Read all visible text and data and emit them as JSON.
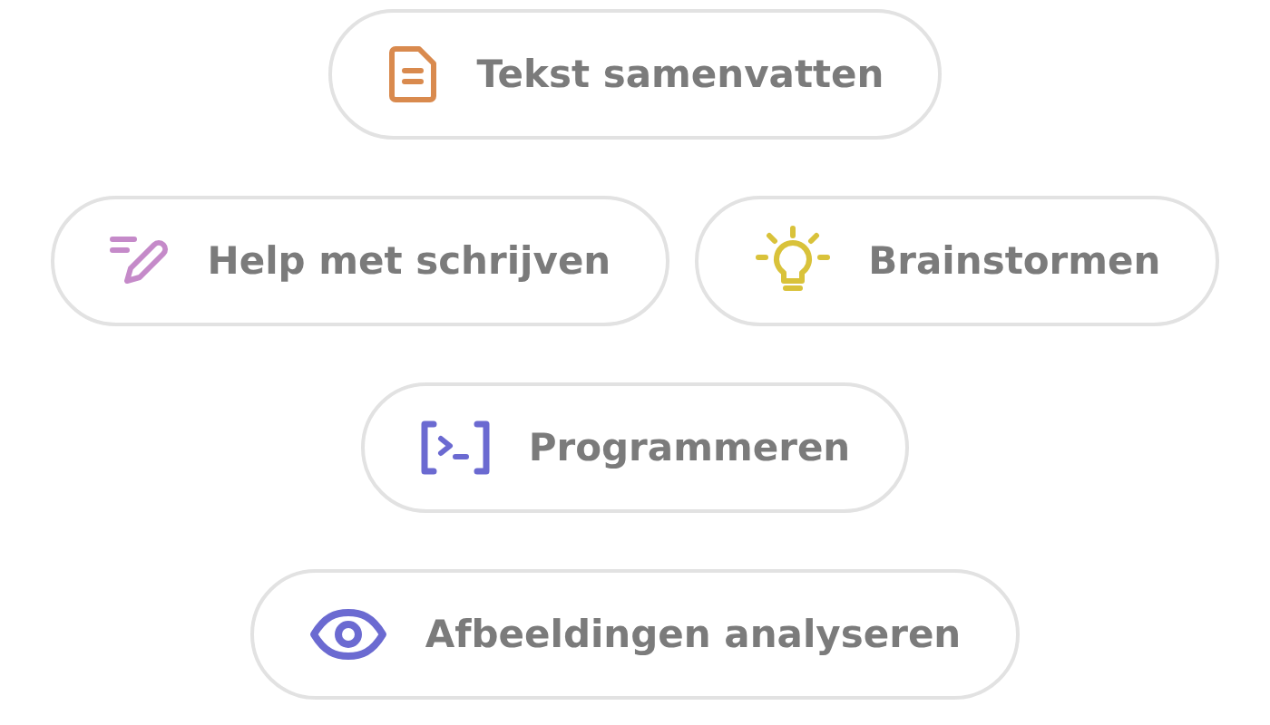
{
  "rows": [
    [
      {
        "label": "Tekst samenvatten",
        "kind": "document",
        "color": "#d98a4e"
      }
    ],
    [
      {
        "label": "Help met schrijven",
        "kind": "pen",
        "color": "#c58ac9"
      },
      {
        "label": "Brainstormen",
        "kind": "bulb",
        "color": "#d9c23a"
      }
    ],
    [
      {
        "label": "Programmeren",
        "kind": "code",
        "color": "#6b6ad1"
      }
    ],
    [
      {
        "label": "Afbeeldingen analyseren",
        "kind": "eye",
        "color": "#6b6ad1"
      }
    ]
  ]
}
